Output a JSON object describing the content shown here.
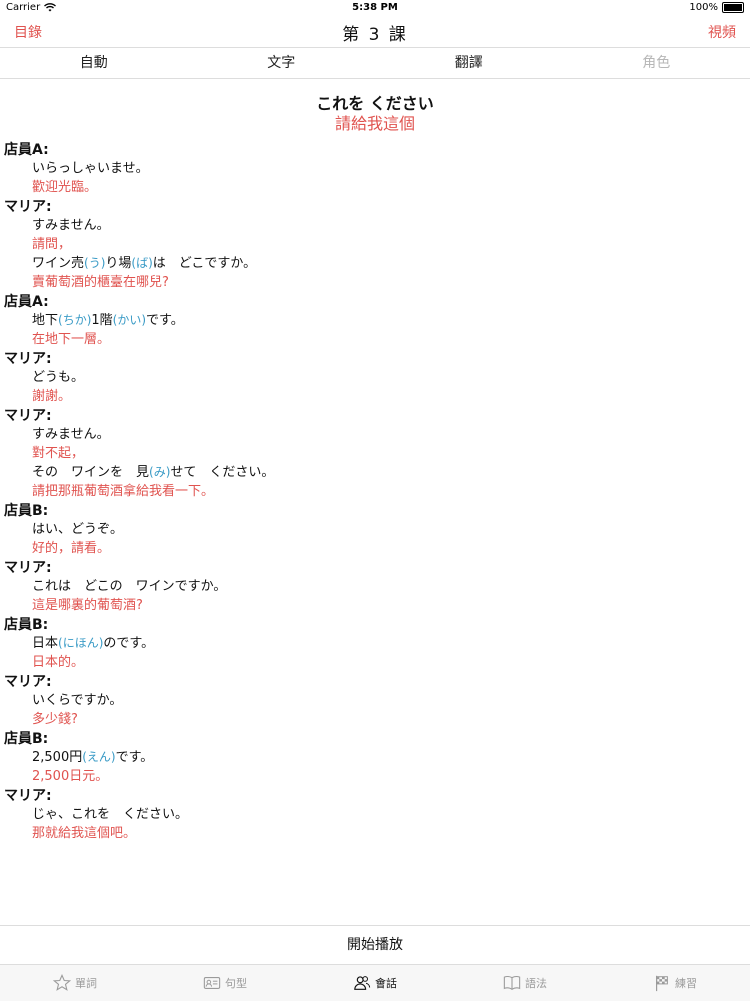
{
  "status": {
    "carrier": "Carrier",
    "time": "5:38 PM",
    "battery": "100%"
  },
  "nav": {
    "left": "目錄",
    "title": "第 3 課",
    "right": "視頻"
  },
  "segments": [
    {
      "label": "自動",
      "disabled": false
    },
    {
      "label": "文字",
      "disabled": false
    },
    {
      "label": "翻譯",
      "disabled": false
    },
    {
      "label": "角色",
      "disabled": true
    }
  ],
  "lesson": {
    "title": "これを ください",
    "translation": "請給我這個"
  },
  "dialogue": [
    {
      "speaker": "店員A:",
      "lines": [
        {
          "ja": [
            {
              "t": "いらっしゃいませ。"
            }
          ],
          "zh": "歡迎光臨。"
        }
      ]
    },
    {
      "speaker": "マリア:",
      "lines": [
        {
          "ja": [
            {
              "t": "すみません。"
            }
          ],
          "zh": "請問，"
        },
        {
          "ja": [
            {
              "t": "ワイン売"
            },
            {
              "r": "(う)"
            },
            {
              "t": "り場"
            },
            {
              "r": "(ば)"
            },
            {
              "t": "は　どこですか。"
            }
          ],
          "zh": "賣葡萄酒的櫃臺在哪兒?"
        }
      ]
    },
    {
      "speaker": "店員A:",
      "lines": [
        {
          "ja": [
            {
              "t": "地下"
            },
            {
              "r": "(ちか)"
            },
            {
              "t": "1階"
            },
            {
              "r": "(かい)"
            },
            {
              "t": "です。"
            }
          ],
          "zh": "在地下一層。"
        }
      ]
    },
    {
      "speaker": "マリア:",
      "lines": [
        {
          "ja": [
            {
              "t": "どうも。"
            }
          ],
          "zh": "謝謝。"
        }
      ]
    },
    {
      "speaker": "マリア:",
      "lines": [
        {
          "ja": [
            {
              "t": "すみません。"
            }
          ],
          "zh": "對不起，"
        },
        {
          "ja": [
            {
              "t": "その　ワインを　見"
            },
            {
              "r": "(み)"
            },
            {
              "t": "せて　ください。"
            }
          ],
          "zh": "請把那瓶葡萄酒拿給我看一下。"
        }
      ]
    },
    {
      "speaker": "店員B:",
      "lines": [
        {
          "ja": [
            {
              "t": "はい、どうぞ。"
            }
          ],
          "zh": "好的，請看。"
        }
      ]
    },
    {
      "speaker": "マリア:",
      "lines": [
        {
          "ja": [
            {
              "t": "これは　どこの　ワインですか。"
            }
          ],
          "zh": "這是哪裏的葡萄酒?"
        }
      ]
    },
    {
      "speaker": "店員B:",
      "lines": [
        {
          "ja": [
            {
              "t": "日本"
            },
            {
              "r": "(にほん)"
            },
            {
              "t": "のです。"
            }
          ],
          "zh": "日本的。"
        }
      ]
    },
    {
      "speaker": "マリア:",
      "lines": [
        {
          "ja": [
            {
              "t": "いくらですか。"
            }
          ],
          "zh": "多少錢?"
        }
      ]
    },
    {
      "speaker": "店員B:",
      "lines": [
        {
          "ja": [
            {
              "t": "2,500円"
            },
            {
              "r": "(えん)"
            },
            {
              "t": "です。"
            }
          ],
          "zh": "2,500日元。"
        }
      ]
    },
    {
      "speaker": "マリア:",
      "lines": [
        {
          "ja": [
            {
              "t": "じゃ、これを　ください。"
            }
          ],
          "zh": "那就給我這個吧。"
        }
      ]
    }
  ],
  "play_button": "開始播放",
  "tabs": [
    {
      "label": "單詞",
      "icon": "star-icon",
      "active": false
    },
    {
      "label": "句型",
      "icon": "card-icon",
      "active": false
    },
    {
      "label": "會話",
      "icon": "people-icon",
      "active": true
    },
    {
      "label": "語法",
      "icon": "book-icon",
      "active": false
    },
    {
      "label": "練習",
      "icon": "flag-icon",
      "active": false
    }
  ],
  "colors": {
    "accent": "#e0534f",
    "ruby": "#3a9bc6",
    "disabled": "#b7b7b7"
  }
}
